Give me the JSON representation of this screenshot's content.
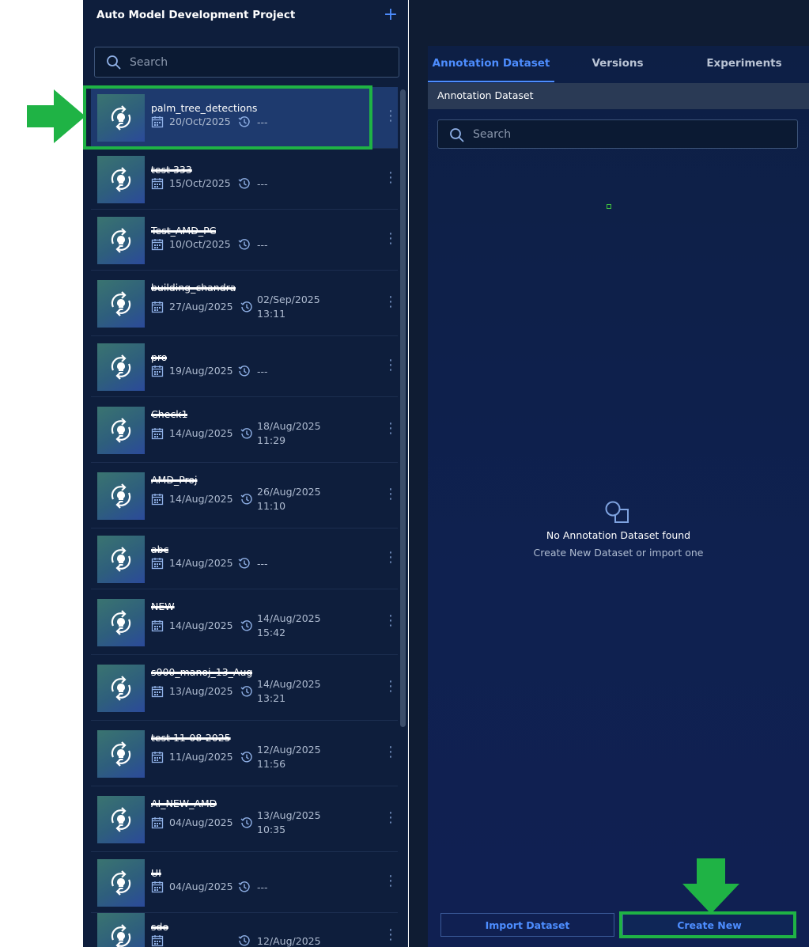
{
  "project": {
    "title": "Auto Model Development Project",
    "add_icon": "plus-icon"
  },
  "left_search": {
    "placeholder": "Search"
  },
  "items": [
    {
      "name": "palm_tree_detections",
      "redacted": false,
      "created": "20/Oct/2025",
      "updated": "---",
      "updated_time": ""
    },
    {
      "name": "test 333",
      "redacted": true,
      "created": "15/Oct/2025",
      "updated": "---",
      "updated_time": ""
    },
    {
      "name": "Test_AMD_PC",
      "redacted": true,
      "created": "10/Oct/2025",
      "updated": "---",
      "updated_time": ""
    },
    {
      "name": "building_chandra",
      "redacted": true,
      "created": "27/Aug/2025",
      "updated": "02/Sep/2025",
      "updated_time": "13:11"
    },
    {
      "name": "pro",
      "redacted": true,
      "created": "19/Aug/2025",
      "updated": "---",
      "updated_time": ""
    },
    {
      "name": "Check1",
      "redacted": true,
      "created": "14/Aug/2025",
      "updated": "18/Aug/2025",
      "updated_time": "11:29"
    },
    {
      "name": "AMD_Proj",
      "redacted": true,
      "created": "14/Aug/2025",
      "updated": "26/Aug/2025",
      "updated_time": "11:10"
    },
    {
      "name": "abc",
      "redacted": true,
      "created": "14/Aug/2025",
      "updated": "---",
      "updated_time": ""
    },
    {
      "name": "NEW",
      "redacted": true,
      "created": "14/Aug/2025",
      "updated": "14/Aug/2025",
      "updated_time": "15:42"
    },
    {
      "name": "s000_manoj_13_Aug",
      "redacted": true,
      "created": "13/Aug/2025",
      "updated": "14/Aug/2025",
      "updated_time": "13:21"
    },
    {
      "name": "test 11-08-2025",
      "redacted": true,
      "created": "11/Aug/2025",
      "updated": "12/Aug/2025",
      "updated_time": "11:56"
    },
    {
      "name": "AI_NEW_AMD",
      "redacted": true,
      "created": "04/Aug/2025",
      "updated": "13/Aug/2025",
      "updated_time": "10:35"
    },
    {
      "name": "UI",
      "redacted": true,
      "created": "04/Aug/2025",
      "updated": "---",
      "updated_time": ""
    },
    {
      "name": "sdo",
      "redacted": true,
      "created": "",
      "updated": "12/Aug/2025",
      "updated_time": ""
    }
  ],
  "tabs": [
    "Annotation Dataset",
    "Versions",
    "Experiments"
  ],
  "active_tab": 0,
  "section_title": "Annotation Dataset",
  "right_search": {
    "placeholder": "Search"
  },
  "empty_state": {
    "title": "No Annotation Dataset found",
    "subtitle": "Create New Dataset or import one"
  },
  "buttons": {
    "import": "Import Dataset",
    "create": "Create New"
  },
  "colors": {
    "accent": "#4d8dff",
    "panel": "#0e1e3c",
    "highlight": "#1fb345"
  }
}
